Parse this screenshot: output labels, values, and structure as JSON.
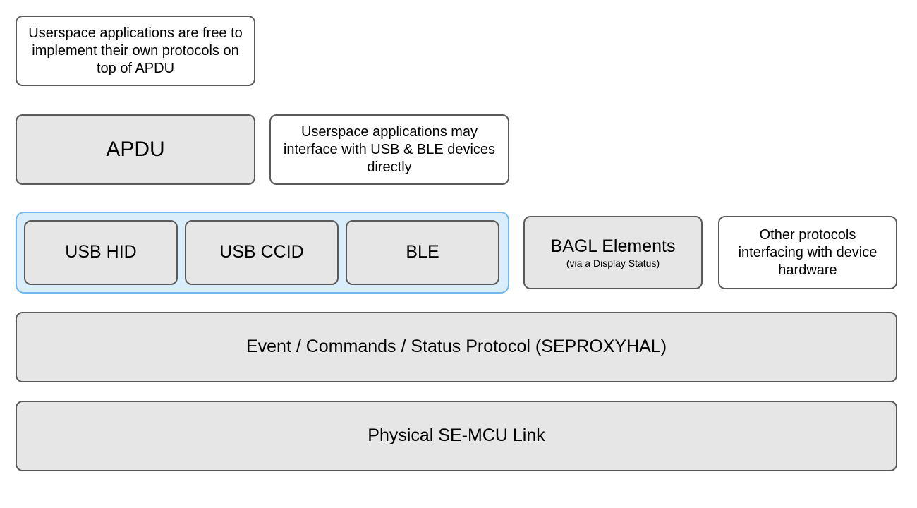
{
  "row1": {
    "note_apdu_top": "Userspace applications are free to implement their own protocols on top of APDU"
  },
  "row2": {
    "apdu": "APDU",
    "note_usb_ble": "Userspace applications may interface with USB & BLE devices directly"
  },
  "row3": {
    "usb_hid": "USB HID",
    "usb_ccid": "USB CCID",
    "ble": "BLE",
    "bagl": "BAGL Elements",
    "bagl_sub": "(via a Display Status)",
    "other_proto": "Other protocols interfacing with device hardware"
  },
  "row4": {
    "seproxyhal": "Event / Commands / Status Protocol (SEPROXYHAL)"
  },
  "row5": {
    "physical": "Physical SE-MCU Link"
  }
}
